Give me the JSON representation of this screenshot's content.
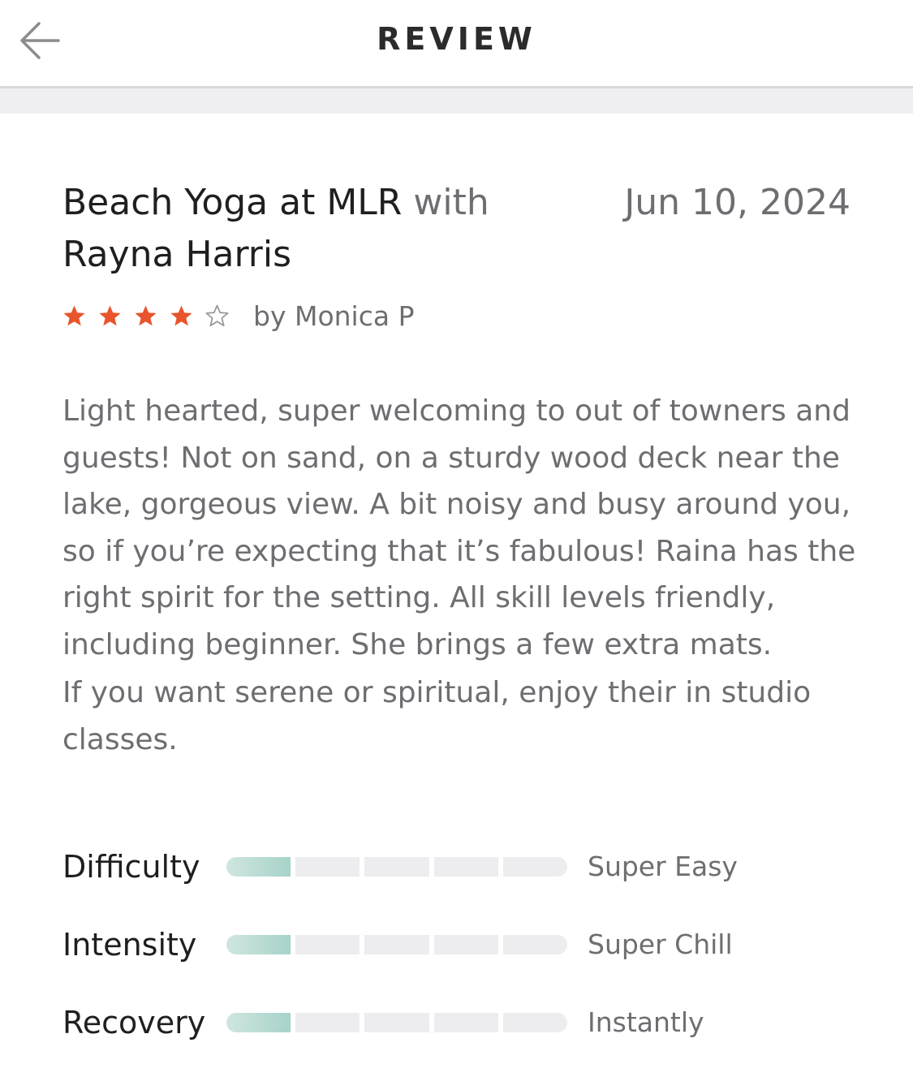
{
  "header": {
    "title": "REVIEW",
    "back_icon": "arrow-left-icon"
  },
  "class_info": {
    "class_name": "Beach Yoga at MLR",
    "with_word": "with",
    "instructor": "Rayna Harris",
    "date": "Jun 10, 2024"
  },
  "rating": {
    "stars": 4,
    "max_stars": 5,
    "author": "by Monica P",
    "star_color": "#e8542c",
    "empty_star_color": "#9a9a9e"
  },
  "review": {
    "paragraphs": [
      "Light hearted, super welcoming to out of towners and guests! Not on sand, on a sturdy wood deck near the lake, gorgeous view. A bit noisy and busy around you, so if you’re expecting that it’s fabulous! Raina has the right spirit for the setting. All skill levels friendly, including beginner. She brings a few extra mats.",
      "If you want serene or spiritual, enjoy their in studio classes."
    ]
  },
  "metrics": [
    {
      "label": "Difficulty",
      "level": 1,
      "max": 5,
      "value": "Super Easy"
    },
    {
      "label": "Intensity",
      "level": 1,
      "max": 5,
      "value": "Super Chill"
    },
    {
      "label": "Recovery",
      "level": 1,
      "max": 5,
      "value": "Instantly"
    }
  ],
  "colors": {
    "bar_filled": "#a6d3c9",
    "bar_empty": "#ededf0"
  }
}
